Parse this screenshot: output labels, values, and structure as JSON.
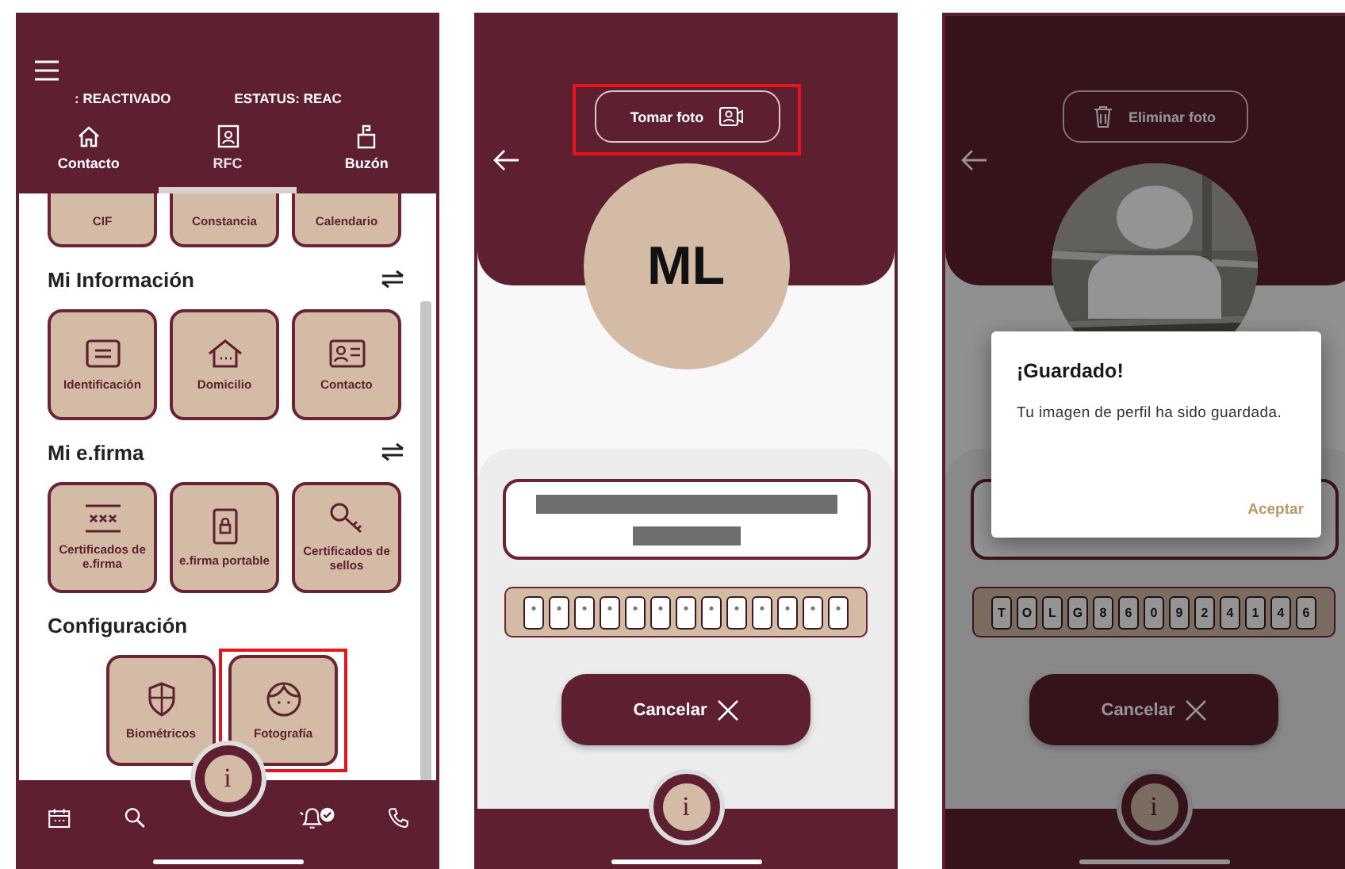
{
  "menu_screen": {
    "status_texts": [
      ": REACTIVADO",
      "ESTATUS: REAC"
    ],
    "tabs": [
      {
        "label": "Contacto",
        "selected": false
      },
      {
        "label": "RFC",
        "selected": true
      },
      {
        "label": "Buzón",
        "selected": false
      }
    ],
    "sections": [
      {
        "tiles": [
          {
            "label": "CIF",
            "highlighted": false
          },
          {
            "label": "Constancia",
            "highlighted": false
          },
          {
            "label": "Calendario",
            "highlighted": false
          }
        ]
      },
      {
        "title": "Mi Información",
        "swap_button": true,
        "tiles": [
          {
            "label": "Identificación",
            "highlighted": false
          },
          {
            "label": "Domicilio",
            "highlighted": false
          },
          {
            "label": "Contacto",
            "highlighted": false
          }
        ]
      },
      {
        "title": "Mi e.firma",
        "swap_button": true,
        "tiles": [
          {
            "label": "Certificados de e.firma",
            "highlighted": false
          },
          {
            "label": "e.firma portable",
            "highlighted": false
          },
          {
            "label": "Certificados de sellos",
            "highlighted": false
          }
        ]
      },
      {
        "title": "Configuración",
        "swap_button": false,
        "tiles": [
          {
            "label": "Biométricos",
            "highlighted": false
          },
          {
            "label": "Fotografía",
            "highlighted": true
          }
        ]
      }
    ],
    "info_button": "i"
  },
  "photo_screen": {
    "action_button": {
      "label": "Tomar foto",
      "highlighted": true
    },
    "avatar_initials": "ML",
    "name_field": {
      "redacted": true
    },
    "rfc_chars": [
      {
        "redacted": true
      },
      {
        "redacted": true
      },
      {
        "redacted": true
      },
      {
        "redacted": true
      },
      {
        "redacted": true
      },
      {
        "redacted": true
      },
      {
        "redacted": true
      },
      {
        "redacted": true
      },
      {
        "redacted": true
      },
      {
        "redacted": true
      },
      {
        "redacted": true
      },
      {
        "redacted": true
      },
      {
        "redacted": true
      }
    ],
    "cancel_button": "Cancelar",
    "info_button": "i"
  },
  "saved_screen": {
    "action_button": {
      "label": "Eliminar foto",
      "highlighted": false
    },
    "rfc_chars": [
      "T",
      "O",
      "L",
      "G",
      "8",
      "6",
      "0",
      "9",
      "2",
      "4",
      "1",
      "4",
      "6"
    ],
    "cancel_button": "Cancelar",
    "info_button": "i",
    "dialog": {
      "title": "¡Guardado!",
      "message": "Tu imagen de perfil ha sido guardada.",
      "button": "Aceptar"
    }
  }
}
